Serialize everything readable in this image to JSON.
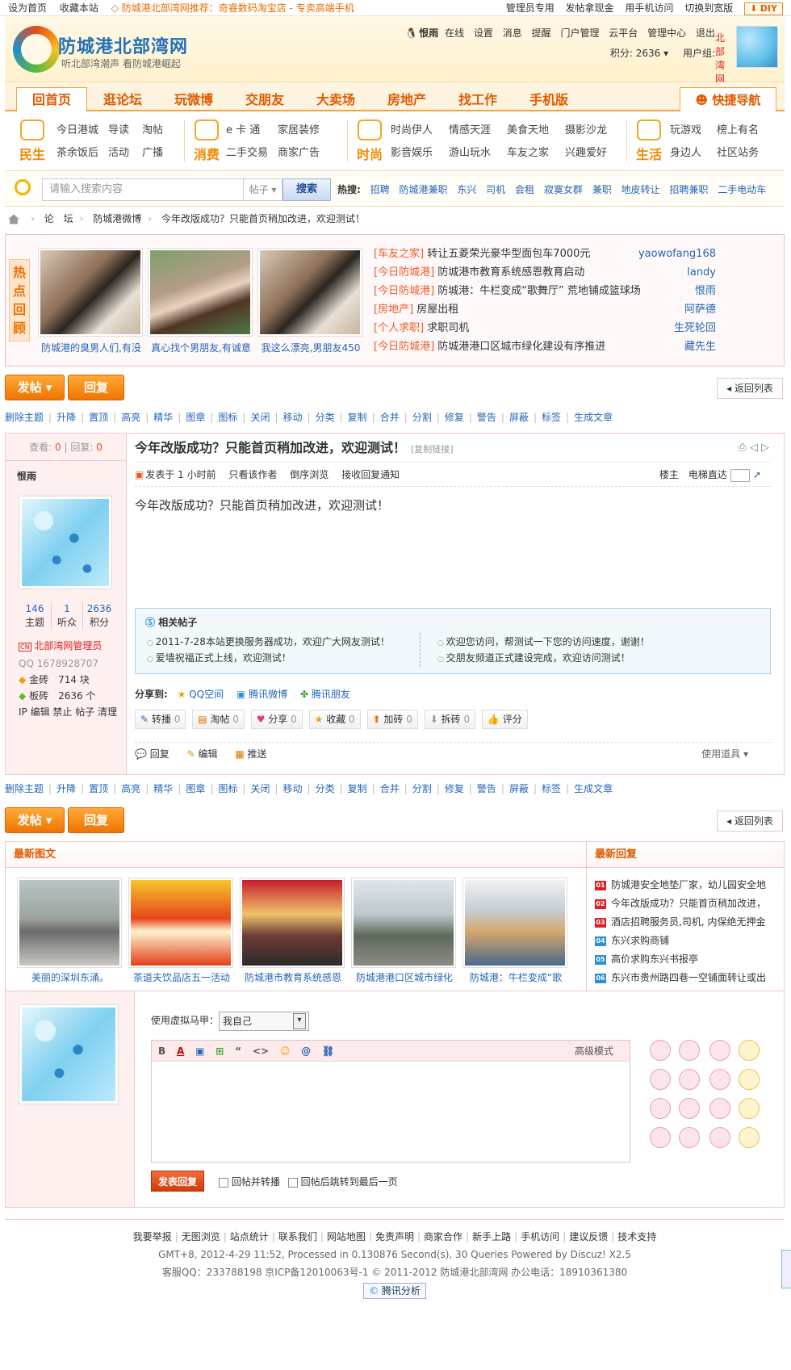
{
  "topbar": {
    "left": [
      "设为首页",
      "收藏本站"
    ],
    "promo": "◇ 防城港北部湾网推荐：奇睿数码淘宝店 - 专卖高端手机",
    "right": [
      "管理员专用",
      "发帖拿现金",
      "用手机访问",
      "切换到宽版"
    ],
    "diy": "DIY"
  },
  "header": {
    "site_name": "防城港北部湾网",
    "slogan": "听北部湾潮声 看防城港崛起",
    "user_name": "恨雨",
    "user_links": [
      "在线",
      "设置",
      "消息",
      "提醒",
      "门户管理",
      "云平台",
      "管理中心",
      "退出"
    ],
    "points": "积分: 2636",
    "group_label": "用户组:",
    "group": "北部湾网管理员"
  },
  "nav": {
    "items": [
      "回首页",
      "逛论坛",
      "玩微博",
      "交朋友",
      "大卖场",
      "房地产",
      "找工作",
      "手机版"
    ],
    "quick": "快捷导航"
  },
  "subnav": [
    {
      "label": "民生",
      "links": [
        "今日港城",
        "导读",
        "淘帖",
        "茶余饭后",
        "活动",
        "广播"
      ]
    },
    {
      "label": "消费",
      "links": [
        "e 卡 通",
        "家居装修",
        "二手交易",
        "商家广告"
      ]
    },
    {
      "label": "时尚",
      "links": [
        "时尚伊人",
        "情感天涯",
        "美食天地",
        "摄影沙龙",
        "影音娱乐",
        "游山玩水",
        "车友之家",
        "兴趣爱好"
      ]
    },
    {
      "label": "生活",
      "links": [
        "玩游戏",
        "榜上有名",
        "身边人",
        "社区站务"
      ]
    }
  ],
  "search": {
    "placeholder": "请输入搜索内容",
    "scope": "帖子",
    "button": "搜索",
    "hot_label": "热搜:",
    "hot": [
      "招聘",
      "防城港兼职",
      "东兴",
      "司机",
      "会租",
      "寂寞女群",
      "兼职",
      "地皮转让",
      "招聘兼职",
      "二手电动车"
    ]
  },
  "breadcrumb": [
    "论　坛",
    "防城港微博",
    "今年改版成功？只能首页稍加改进，欢迎测试！"
  ],
  "review": {
    "tag": "热点回顾",
    "pics": [
      "防城港的臭男人们,有没",
      "真心找个男朋友,有诚意",
      "我这么漂亮,男朋友450"
    ],
    "items": [
      {
        "cat": "[车友之家]",
        "title": "转让五菱荣光豪华型面包车7000元",
        "who": "yaowofang168"
      },
      {
        "cat": "[今日防城港]",
        "title": "防城港市教育系统感恩教育启动",
        "who": "landy"
      },
      {
        "cat": "[今日防城港]",
        "title": "防城港：牛栏变成“歌舞厅” 荒地铺成篮球场",
        "who": "恨雨"
      },
      {
        "cat": "[房地产]",
        "title": "房屋出租",
        "who": "阿萨德"
      },
      {
        "cat": "[个人求职]",
        "title": "求职司机",
        "who": "生死轮回"
      },
      {
        "cat": "[今日防城港]",
        "title": "防城港港口区城市绿化建设有序推进",
        "who": "藏先生"
      }
    ]
  },
  "actions": {
    "post": "发帖 ▾",
    "reply": "回复",
    "back": "◂ 返回列表"
  },
  "mod_tools": [
    "删除主题",
    "升降",
    "置顶",
    "高亮",
    "精华",
    "图章",
    "图标",
    "关闭",
    "移动",
    "分类",
    "复制",
    "合并",
    "分割",
    "修复",
    "警告",
    "屏蔽",
    "标签",
    "生成文章"
  ],
  "post": {
    "views_label": "查看:",
    "views": "0",
    "replies_label": "回复:",
    "replies": "0",
    "title": "今年改版成功？只能首页稍加改进，欢迎测试！",
    "copy_link": "[复制链接]",
    "author": "恨雨",
    "meta": [
      "发表于 1 小时前",
      "只看该作者",
      "倒序浏览",
      "接收回复通知"
    ],
    "floor": "楼主",
    "jump": "电梯直达",
    "content": "今年改版成功？只能首页稍加改进，欢迎测试！",
    "stats": [
      {
        "n": "146",
        "l": "主题"
      },
      {
        "n": "1",
        "l": "听众"
      },
      {
        "n": "2636",
        "l": "积分"
      }
    ],
    "group": "北部湾网管理员",
    "qq": "QQ 1678928707",
    "gold": "金砖　714 块",
    "brick": "板砖　2636 个",
    "admin_links": "IP 编辑 禁止 帖子 清理",
    "related_title": "相关帖子",
    "related_left": [
      "2011-7-28本站更换服务器成功，欢迎广大网友测试！",
      "爱墙祝福正式上线，欢迎测试！"
    ],
    "related_right": [
      "欢迎您访问，帮测试一下您的访问速度，谢谢！",
      "交朋友频道正式建设完成，欢迎访问测试！"
    ],
    "share_label": "分享到:",
    "share": [
      "QQ空间",
      "腾讯微博",
      "腾讯朋友"
    ],
    "tools": [
      {
        "l": "转播",
        "n": "0"
      },
      {
        "l": "淘帖",
        "n": "0"
      },
      {
        "l": "分享",
        "n": "0"
      },
      {
        "l": "收藏",
        "n": "0"
      },
      {
        "l": "加砖",
        "n": "0"
      },
      {
        "l": "拆砖",
        "n": "0"
      },
      {
        "l": "评分",
        "n": ""
      }
    ],
    "foot": [
      "回复",
      "编辑",
      "推送"
    ],
    "use_tool": "使用道具 ▾"
  },
  "latest": {
    "title": "最新图文",
    "pics": [
      "美丽的深圳东涌。",
      "茶道夫饮品店五一活动",
      "防城港市教育系统感恩",
      "防城港港口区城市绿化",
      "防城港：牛栏变成“歌"
    ],
    "reply_title": "最新回复",
    "replies": [
      "防城港安全地垫厂家，幼儿园安全地",
      "今年改版成功？只能首页稍加改进，",
      "酒店招聘服务员,司机, 内保绝无押金",
      "东兴求购商铺",
      "高价求购东兴书报亭",
      "东兴市贵州路四巷一空铺面转让或出"
    ],
    "reply_nums": [
      "01",
      "02",
      "03",
      "04",
      "05",
      "06"
    ],
    "num_colors": [
      "#e02020",
      "#e02020",
      "#e02020",
      "#2a8fd8",
      "#2a8fd8",
      "#2a8fd8"
    ]
  },
  "reply": {
    "vest_label": "使用虚拟马甲：",
    "vest_value": "我自己",
    "toolbar": [
      "B",
      "A",
      "▣",
      "⊞",
      "“",
      "<>",
      "☺",
      "@",
      "⛓"
    ],
    "advanced": "高级模式",
    "submit": "发表回复",
    "opt1": "回帖并转播",
    "opt2": "回帖后跳转到最后一页"
  },
  "footer": {
    "links": [
      "我要举报",
      "无图浏览",
      "站点统计",
      "联系我们",
      "网站地图",
      "免责声明",
      "商家合作",
      "新手上路",
      "手机访问",
      "建议反馈",
      "技术支持"
    ],
    "line2": "GMT+8, 2012-4-29 11:52, Processed in 0.130876 Second(s), 30 Queries Powered by Discuz! X2.5",
    "line3": "客服QQ：233788198 京ICP备12010063号-1 © 2011-2012 防城港北部湾网 办公电话：18910361380",
    "badge": "腾讯分析"
  }
}
